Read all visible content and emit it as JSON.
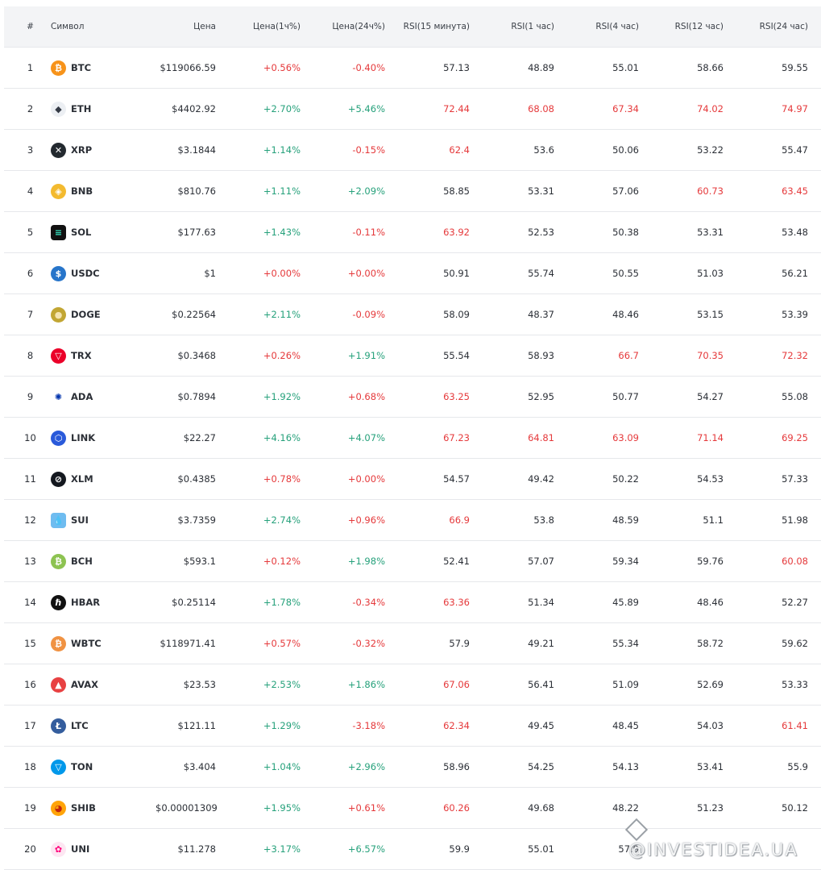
{
  "columns": [
    "#",
    "Символ",
    "Цена",
    "Цена(1ч%)",
    "Цена(24ч%)",
    "RSI(15 минута)",
    "RSI(1 час)",
    "RSI(4 час)",
    "RSI(12 час)",
    "RSI(24 час)"
  ],
  "colors": {
    "positive": "#26a17b",
    "negative": "#e5393b",
    "neutral": "#2b2f36",
    "header_bg": "#f3f4f6",
    "divider": "#e6e8eb"
  },
  "rows": [
    {
      "n": "1",
      "sym": "BTC",
      "icon": "btc-icon",
      "price": "$119066.59",
      "h1": "+0.56%",
      "h1c": "neg",
      "d24": "-0.40%",
      "d24c": "neg",
      "r15": "57.13",
      "r15c": "",
      "r1": "48.89",
      "r1c": "",
      "r4": "55.01",
      "r4c": "",
      "r12": "58.66",
      "r12c": "",
      "r24": "59.55",
      "r24c": ""
    },
    {
      "n": "2",
      "sym": "ETH",
      "icon": "eth-icon",
      "price": "$4402.92",
      "h1": "+2.70%",
      "h1c": "pos",
      "d24": "+5.46%",
      "d24c": "pos",
      "r15": "72.44",
      "r15c": "neg",
      "r1": "68.08",
      "r1c": "neg",
      "r4": "67.34",
      "r4c": "neg",
      "r12": "74.02",
      "r12c": "neg",
      "r24": "74.97",
      "r24c": "neg"
    },
    {
      "n": "3",
      "sym": "XRP",
      "icon": "xrp-icon",
      "price": "$3.1844",
      "h1": "+1.14%",
      "h1c": "pos",
      "d24": "-0.15%",
      "d24c": "neg",
      "r15": "62.4",
      "r15c": "neg",
      "r1": "53.6",
      "r1c": "",
      "r4": "50.06",
      "r4c": "",
      "r12": "53.22",
      "r12c": "",
      "r24": "55.47",
      "r24c": ""
    },
    {
      "n": "4",
      "sym": "BNB",
      "icon": "bnb-icon",
      "price": "$810.76",
      "h1": "+1.11%",
      "h1c": "pos",
      "d24": "+2.09%",
      "d24c": "pos",
      "r15": "58.85",
      "r15c": "",
      "r1": "53.31",
      "r1c": "",
      "r4": "57.06",
      "r4c": "",
      "r12": "60.73",
      "r12c": "neg",
      "r24": "63.45",
      "r24c": "neg"
    },
    {
      "n": "5",
      "sym": "SOL",
      "icon": "sol-icon",
      "price": "$177.63",
      "h1": "+1.43%",
      "h1c": "pos",
      "d24": "-0.11%",
      "d24c": "neg",
      "r15": "63.92",
      "r15c": "neg",
      "r1": "52.53",
      "r1c": "",
      "r4": "50.38",
      "r4c": "",
      "r12": "53.31",
      "r12c": "",
      "r24": "53.48",
      "r24c": ""
    },
    {
      "n": "6",
      "sym": "USDC",
      "icon": "usdc-icon",
      "price": "$1",
      "h1": "+0.00%",
      "h1c": "neg",
      "d24": "+0.00%",
      "d24c": "neg",
      "r15": "50.91",
      "r15c": "",
      "r1": "55.74",
      "r1c": "",
      "r4": "50.55",
      "r4c": "",
      "r12": "51.03",
      "r12c": "",
      "r24": "56.21",
      "r24c": ""
    },
    {
      "n": "7",
      "sym": "DOGE",
      "icon": "doge-icon",
      "price": "$0.22564",
      "h1": "+2.11%",
      "h1c": "pos",
      "d24": "-0.09%",
      "d24c": "neg",
      "r15": "58.09",
      "r15c": "",
      "r1": "48.37",
      "r1c": "",
      "r4": "48.46",
      "r4c": "",
      "r12": "53.15",
      "r12c": "",
      "r24": "53.39",
      "r24c": ""
    },
    {
      "n": "8",
      "sym": "TRX",
      "icon": "trx-icon",
      "price": "$0.3468",
      "h1": "+0.26%",
      "h1c": "neg",
      "d24": "+1.91%",
      "d24c": "pos",
      "r15": "55.54",
      "r15c": "",
      "r1": "58.93",
      "r1c": "",
      "r4": "66.7",
      "r4c": "neg",
      "r12": "70.35",
      "r12c": "neg",
      "r24": "72.32",
      "r24c": "neg"
    },
    {
      "n": "9",
      "sym": "ADA",
      "icon": "ada-icon",
      "price": "$0.7894",
      "h1": "+1.92%",
      "h1c": "pos",
      "d24": "+0.68%",
      "d24c": "neg",
      "r15": "63.25",
      "r15c": "neg",
      "r1": "52.95",
      "r1c": "",
      "r4": "50.77",
      "r4c": "",
      "r12": "54.27",
      "r12c": "",
      "r24": "55.08",
      "r24c": ""
    },
    {
      "n": "10",
      "sym": "LINK",
      "icon": "link-icon",
      "price": "$22.27",
      "h1": "+4.16%",
      "h1c": "pos",
      "d24": "+4.07%",
      "d24c": "pos",
      "r15": "67.23",
      "r15c": "neg",
      "r1": "64.81",
      "r1c": "neg",
      "r4": "63.09",
      "r4c": "neg",
      "r12": "71.14",
      "r12c": "neg",
      "r24": "69.25",
      "r24c": "neg"
    },
    {
      "n": "11",
      "sym": "XLM",
      "icon": "xlm-icon",
      "price": "$0.4385",
      "h1": "+0.78%",
      "h1c": "neg",
      "d24": "+0.00%",
      "d24c": "neg",
      "r15": "54.57",
      "r15c": "",
      "r1": "49.42",
      "r1c": "",
      "r4": "50.22",
      "r4c": "",
      "r12": "54.53",
      "r12c": "",
      "r24": "57.33",
      "r24c": ""
    },
    {
      "n": "12",
      "sym": "SUI",
      "icon": "sui-icon",
      "price": "$3.7359",
      "h1": "+2.74%",
      "h1c": "pos",
      "d24": "+0.96%",
      "d24c": "neg",
      "r15": "66.9",
      "r15c": "neg",
      "r1": "53.8",
      "r1c": "",
      "r4": "48.59",
      "r4c": "",
      "r12": "51.1",
      "r12c": "",
      "r24": "51.98",
      "r24c": ""
    },
    {
      "n": "13",
      "sym": "BCH",
      "icon": "bch-icon",
      "price": "$593.1",
      "h1": "+0.12%",
      "h1c": "neg",
      "d24": "+1.98%",
      "d24c": "pos",
      "r15": "52.41",
      "r15c": "",
      "r1": "57.07",
      "r1c": "",
      "r4": "59.34",
      "r4c": "",
      "r12": "59.76",
      "r12c": "",
      "r24": "60.08",
      "r24c": "neg"
    },
    {
      "n": "14",
      "sym": "HBAR",
      "icon": "hbar-icon",
      "price": "$0.25114",
      "h1": "+1.78%",
      "h1c": "pos",
      "d24": "-0.34%",
      "d24c": "neg",
      "r15": "63.36",
      "r15c": "neg",
      "r1": "51.34",
      "r1c": "",
      "r4": "45.89",
      "r4c": "",
      "r12": "48.46",
      "r12c": "",
      "r24": "52.27",
      "r24c": ""
    },
    {
      "n": "15",
      "sym": "WBTC",
      "icon": "wbtc-icon",
      "price": "$118971.41",
      "h1": "+0.57%",
      "h1c": "neg",
      "d24": "-0.32%",
      "d24c": "neg",
      "r15": "57.9",
      "r15c": "",
      "r1": "49.21",
      "r1c": "",
      "r4": "55.34",
      "r4c": "",
      "r12": "58.72",
      "r12c": "",
      "r24": "59.62",
      "r24c": ""
    },
    {
      "n": "16",
      "sym": "AVAX",
      "icon": "avax-icon",
      "price": "$23.53",
      "h1": "+2.53%",
      "h1c": "pos",
      "d24": "+1.86%",
      "d24c": "pos",
      "r15": "67.06",
      "r15c": "neg",
      "r1": "56.41",
      "r1c": "",
      "r4": "51.09",
      "r4c": "",
      "r12": "52.69",
      "r12c": "",
      "r24": "53.33",
      "r24c": ""
    },
    {
      "n": "17",
      "sym": "LTC",
      "icon": "ltc-icon",
      "price": "$121.11",
      "h1": "+1.29%",
      "h1c": "pos",
      "d24": "-3.18%",
      "d24c": "neg",
      "r15": "62.34",
      "r15c": "neg",
      "r1": "49.45",
      "r1c": "",
      "r4": "48.45",
      "r4c": "",
      "r12": "54.03",
      "r12c": "",
      "r24": "61.41",
      "r24c": "neg"
    },
    {
      "n": "18",
      "sym": "TON",
      "icon": "ton-icon",
      "price": "$3.404",
      "h1": "+1.04%",
      "h1c": "pos",
      "d24": "+2.96%",
      "d24c": "pos",
      "r15": "58.96",
      "r15c": "",
      "r1": "54.25",
      "r1c": "",
      "r4": "54.13",
      "r4c": "",
      "r12": "53.41",
      "r12c": "",
      "r24": "55.9",
      "r24c": ""
    },
    {
      "n": "19",
      "sym": "SHIB",
      "icon": "shib-icon",
      "price": "$0.00001309",
      "h1": "+1.95%",
      "h1c": "pos",
      "d24": "+0.61%",
      "d24c": "neg",
      "r15": "60.26",
      "r15c": "neg",
      "r1": "49.68",
      "r1c": "",
      "r4": "48.22",
      "r4c": "",
      "r12": "51.23",
      "r12c": "",
      "r24": "50.12",
      "r24c": ""
    },
    {
      "n": "20",
      "sym": "UNI",
      "icon": "uni-icon",
      "price": "$11.278",
      "h1": "+3.17%",
      "h1c": "pos",
      "d24": "+6.57%",
      "d24c": "pos",
      "r15": "59.9",
      "r15c": "",
      "r1": "55.01",
      "r1c": "",
      "r4": "57.9",
      "r4c": "",
      "r12": "",
      "r12c": "neg",
      "r24": "",
      "r24c": "neg"
    }
  ],
  "watermark": "@INVESTIDEA.UA"
}
